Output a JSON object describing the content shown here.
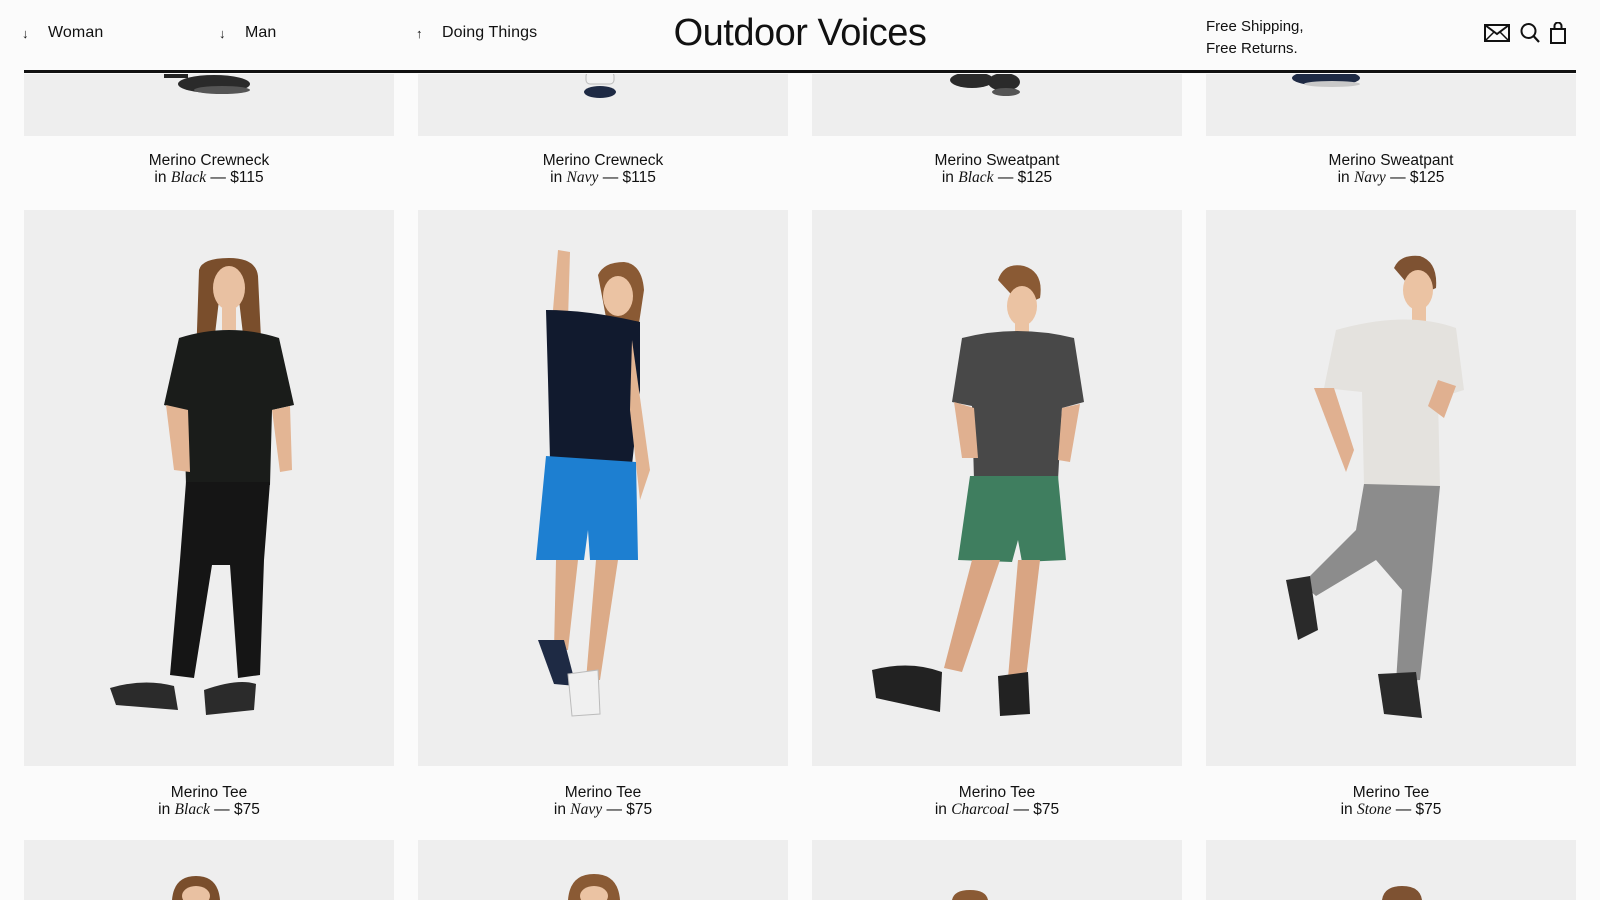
{
  "header": {
    "nav": [
      {
        "arrow": "↓",
        "label": "Woman"
      },
      {
        "arrow": "↓",
        "label": "Man"
      },
      {
        "arrow": "↑",
        "label": "Doing Things"
      }
    ],
    "brand": "Outdoor Voices",
    "shipping_line1": "Free Shipping,",
    "shipping_line2": "Free Returns.",
    "icons": [
      "mail-icon",
      "search-icon",
      "shopping-bag-icon"
    ]
  },
  "products": {
    "row1": [
      {
        "name": "Merino Crewneck",
        "in": "in",
        "color": "Black",
        "price": "— $115"
      },
      {
        "name": "Merino Crewneck",
        "in": "in",
        "color": "Navy",
        "price": "— $115"
      },
      {
        "name": "Merino Sweatpant",
        "in": "in",
        "color": "Black",
        "price": "— $125"
      },
      {
        "name": "Merino Sweatpant",
        "in": "in",
        "color": "Navy",
        "price": "— $125"
      }
    ],
    "row2": [
      {
        "name": "Merino Tee",
        "in": "in",
        "color": "Black",
        "price": "— $75"
      },
      {
        "name": "Merino Tee",
        "in": "in",
        "color": "Navy",
        "price": "— $75"
      },
      {
        "name": "Merino Tee",
        "in": "in",
        "color": "Charcoal",
        "price": "— $75"
      },
      {
        "name": "Merino Tee",
        "in": "in",
        "color": "Stone",
        "price": "— $75"
      }
    ]
  },
  "colors": {
    "photo_bg": "#eeeeee",
    "page_bg": "#fbfbfb",
    "text": "#111111"
  }
}
